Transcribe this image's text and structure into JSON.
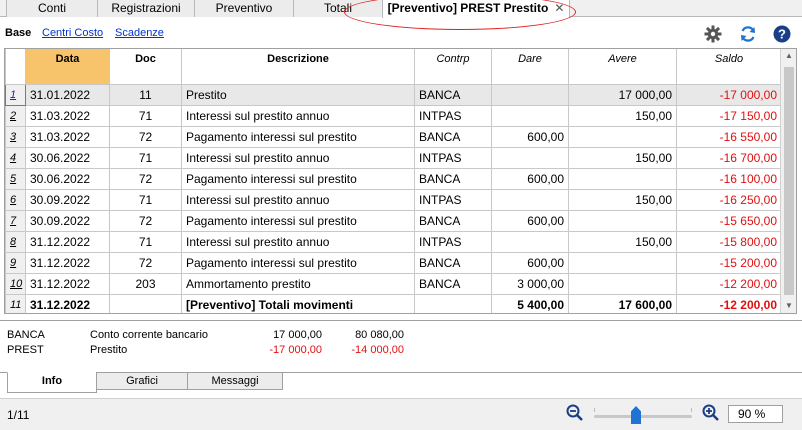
{
  "tabs": [
    {
      "label": "Conti",
      "active": false
    },
    {
      "label": "Registrazioni",
      "active": false
    },
    {
      "label": "Preventivo",
      "active": false
    },
    {
      "label": "Totali",
      "active": false
    },
    {
      "label": "[Preventivo] PREST Prestito",
      "active": true,
      "closable": true
    }
  ],
  "views": {
    "base": "Base",
    "links": [
      "Centri Costo",
      "Scadenze"
    ]
  },
  "toolbar_icons": [
    "gear-icon",
    "refresh-icon",
    "help-icon"
  ],
  "table": {
    "headers": {
      "data": "Data",
      "doc": "Doc",
      "descrizione": "Descrizione",
      "contrp": "Contrp",
      "dare": "Dare",
      "avere": "Avere",
      "saldo": "Saldo"
    },
    "rows": [
      {
        "n": "1",
        "data": "31.01.2022",
        "doc": "11",
        "descrizione": "Prestito",
        "contrp": "BANCA",
        "dare": "",
        "avere": "17 000,00",
        "saldo": "-17 000,00"
      },
      {
        "n": "2",
        "data": "31.03.2022",
        "doc": "71",
        "descrizione": "Interessi sul prestito annuo",
        "contrp": "INTPAS",
        "dare": "",
        "avere": "150,00",
        "saldo": "-17 150,00"
      },
      {
        "n": "3",
        "data": "31.03.2022",
        "doc": "72",
        "descrizione": "Pagamento interessi sul prestito",
        "contrp": "BANCA",
        "dare": "600,00",
        "avere": "",
        "saldo": "-16 550,00"
      },
      {
        "n": "4",
        "data": "30.06.2022",
        "doc": "71",
        "descrizione": "Interessi sul prestito annuo",
        "contrp": "INTPAS",
        "dare": "",
        "avere": "150,00",
        "saldo": "-16 700,00"
      },
      {
        "n": "5",
        "data": "30.06.2022",
        "doc": "72",
        "descrizione": "Pagamento interessi sul prestito",
        "contrp": "BANCA",
        "dare": "600,00",
        "avere": "",
        "saldo": "-16 100,00"
      },
      {
        "n": "6",
        "data": "30.09.2022",
        "doc": "71",
        "descrizione": "Interessi sul prestito annuo",
        "contrp": "INTPAS",
        "dare": "",
        "avere": "150,00",
        "saldo": "-16 250,00"
      },
      {
        "n": "7",
        "data": "30.09.2022",
        "doc": "72",
        "descrizione": "Pagamento interessi sul prestito",
        "contrp": "BANCA",
        "dare": "600,00",
        "avere": "",
        "saldo": "-15 650,00"
      },
      {
        "n": "8",
        "data": "31.12.2022",
        "doc": "71",
        "descrizione": "Interessi sul prestito annuo",
        "contrp": "INTPAS",
        "dare": "",
        "avere": "150,00",
        "saldo": "-15 800,00"
      },
      {
        "n": "9",
        "data": "31.12.2022",
        "doc": "72",
        "descrizione": "Pagamento interessi sul prestito",
        "contrp": "BANCA",
        "dare": "600,00",
        "avere": "",
        "saldo": "-15 200,00"
      },
      {
        "n": "10",
        "data": "31.12.2022",
        "doc": "203",
        "descrizione": "Ammortamento prestito",
        "contrp": "BANCA",
        "dare": "3 000,00",
        "avere": "",
        "saldo": "-12 200,00"
      }
    ],
    "total": {
      "n": "11",
      "data": "31.12.2022",
      "doc": "",
      "descrizione": "[Preventivo] Totali movimenti",
      "contrp": "",
      "dare": "5 400,00",
      "avere": "17 600,00",
      "saldo": "-12 200,00"
    }
  },
  "info": [
    {
      "account": "BANCA",
      "description": "Conto corrente bancario",
      "value1": "17 000,00",
      "value2": "80 080,00",
      "negative": false
    },
    {
      "account": "PREST",
      "description": "Prestito",
      "value1": "-17 000,00",
      "value2": "-14 000,00",
      "negative": true
    }
  ],
  "bottom_tabs": [
    {
      "label": "Info",
      "active": true
    },
    {
      "label": "Grafici",
      "active": false
    },
    {
      "label": "Messaggi",
      "active": false
    }
  ],
  "status": {
    "row_count": "1/11",
    "zoom": "90 %",
    "zoom_level": 90
  },
  "colors": {
    "negative": "#e01010",
    "date_header": "#f7c46c",
    "link": "#0033cc",
    "slider_thumb": "#1e73d4",
    "highlight": "#e02020"
  }
}
